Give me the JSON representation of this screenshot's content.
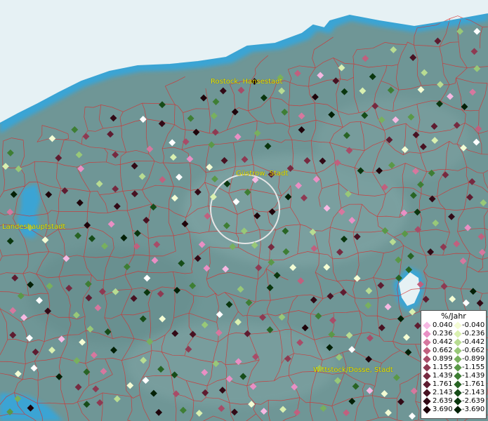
{
  "map": {
    "cities": [
      {
        "name": "Rostock, Hansestadt"
      },
      {
        "name": "Güstrow, Stadt"
      },
      {
        "name": "Landeshauptstadt"
      },
      {
        "name": "Wittstock/Dosse, Stadt"
      }
    ],
    "colors": {
      "land": "#6f9696",
      "sea": "#e6f1f4",
      "coast": "#3aa4d4",
      "borders": "#d43030",
      "highlight_ring": "#e6e6e6",
      "city_label": "#e8e800"
    }
  },
  "legend": {
    "title": "%/Jahr",
    "positive": [
      {
        "label": "0.040",
        "color": "#f6b8e2"
      },
      {
        "label": "0.236",
        "color": "#e98fc4"
      },
      {
        "label": "0.442",
        "color": "#d6779e"
      },
      {
        "label": "0.662",
        "color": "#c0607e"
      },
      {
        "label": "0.899",
        "color": "#a84c68"
      },
      {
        "label": "1.155",
        "color": "#8e3a52"
      },
      {
        "label": "1.439",
        "color": "#762a40"
      },
      {
        "label": "1.761",
        "color": "#5e1c30"
      },
      {
        "label": "2.143",
        "color": "#481222"
      },
      {
        "label": "2.639",
        "color": "#320a16"
      },
      {
        "label": "3.690",
        "color": "#1e040a"
      }
    ],
    "negative": [
      {
        "label": "-0.040",
        "color": "#f4fcd4"
      },
      {
        "label": "-0.236",
        "color": "#d9f0b0"
      },
      {
        "label": "-0.442",
        "color": "#b8dc92"
      },
      {
        "label": "-0.662",
        "color": "#98c878"
      },
      {
        "label": "-0.899",
        "color": "#78b05e"
      },
      {
        "label": "-1.155",
        "color": "#5a9848"
      },
      {
        "label": "-1.439",
        "color": "#3e7e34"
      },
      {
        "label": "-1.761",
        "color": "#286424"
      },
      {
        "label": "-2.143",
        "color": "#164c18"
      },
      {
        "label": "-2.639",
        "color": "#0a360e"
      },
      {
        "label": "-3.690",
        "color": "#032006"
      }
    ]
  }
}
